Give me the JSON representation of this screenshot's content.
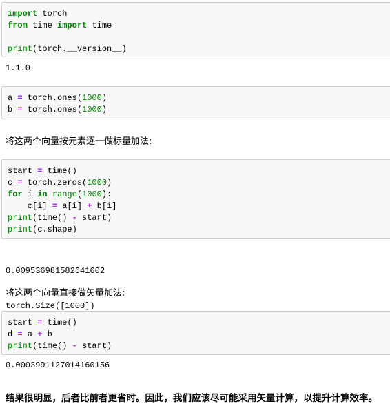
{
  "cells": [
    {
      "lines": [
        [
          [
            "import",
            "kw"
          ],
          [
            " torch",
            ""
          ]
        ],
        [
          [
            "from",
            "kw"
          ],
          [
            " time ",
            ""
          ],
          [
            "import",
            "kw"
          ],
          [
            " time",
            ""
          ]
        ],
        [],
        [
          [
            "print",
            "bi"
          ],
          [
            "(torch.__version__)",
            ""
          ]
        ]
      ],
      "output": [
        "1.1.0"
      ]
    },
    {
      "lines": [
        [
          [
            "a ",
            ""
          ],
          [
            "=",
            "op"
          ],
          [
            " torch.ones(",
            ""
          ],
          [
            "1000",
            "num"
          ],
          [
            ")",
            ""
          ]
        ],
        [
          [
            "b ",
            ""
          ],
          [
            "=",
            "op"
          ],
          [
            " torch.ones(",
            ""
          ],
          [
            "1000",
            "num"
          ],
          [
            ")",
            ""
          ]
        ]
      ],
      "output": []
    },
    {
      "lines": [
        [
          [
            "start ",
            ""
          ],
          [
            "=",
            "op"
          ],
          [
            " time()",
            ""
          ]
        ],
        [
          [
            "c ",
            ""
          ],
          [
            "=",
            "op"
          ],
          [
            " torch.zeros(",
            ""
          ],
          [
            "1000",
            "num"
          ],
          [
            ")",
            ""
          ]
        ],
        [
          [
            "for",
            "kw"
          ],
          [
            " i ",
            ""
          ],
          [
            "in",
            "kw"
          ],
          [
            " ",
            ""
          ],
          [
            "range",
            "bi"
          ],
          [
            "(",
            ""
          ],
          [
            "1000",
            "num"
          ],
          [
            "):",
            ""
          ]
        ],
        [
          [
            "    c[i] ",
            ""
          ],
          [
            "=",
            "op"
          ],
          [
            " a[i] ",
            ""
          ],
          [
            "+",
            "op"
          ],
          [
            " b[i]",
            ""
          ]
        ],
        [
          [
            "print",
            "bi"
          ],
          [
            "(time() ",
            ""
          ],
          [
            "-",
            "op"
          ],
          [
            " start)",
            ""
          ]
        ],
        [
          [
            "print",
            "bi"
          ],
          [
            "(c.shape)",
            ""
          ]
        ]
      ],
      "output": [
        "0.00953698158264160​2",
        "torch.Size([1000])"
      ]
    },
    {
      "lines": [
        [
          [
            "start ",
            ""
          ],
          [
            "=",
            "op"
          ],
          [
            " time()",
            ""
          ]
        ],
        [
          [
            "d ",
            ""
          ],
          [
            "=",
            "op"
          ],
          [
            " a ",
            ""
          ],
          [
            "+",
            "op"
          ],
          [
            " b",
            ""
          ]
        ],
        [
          [
            "print",
            "bi"
          ],
          [
            "(time() ",
            ""
          ],
          [
            "-",
            "op"
          ],
          [
            " start)",
            ""
          ]
        ]
      ],
      "output": [
        "0.0003991127014160156"
      ]
    }
  ],
  "markdown": {
    "elementwise": "将这两个向量按元素逐一做标量加法:",
    "vector": "将这两个向量直接做矢量加法:",
    "conclusion": "结果很明显，后者比前者更省时。因此，我们应该尽可能采用矢量计算，以提升计算效率。"
  },
  "colors": {
    "keyword": "#008000",
    "operator": "#aa22ff",
    "number": "#008000",
    "cell_bg": "#f7f7f7",
    "cell_border": "#cfcfcf"
  }
}
